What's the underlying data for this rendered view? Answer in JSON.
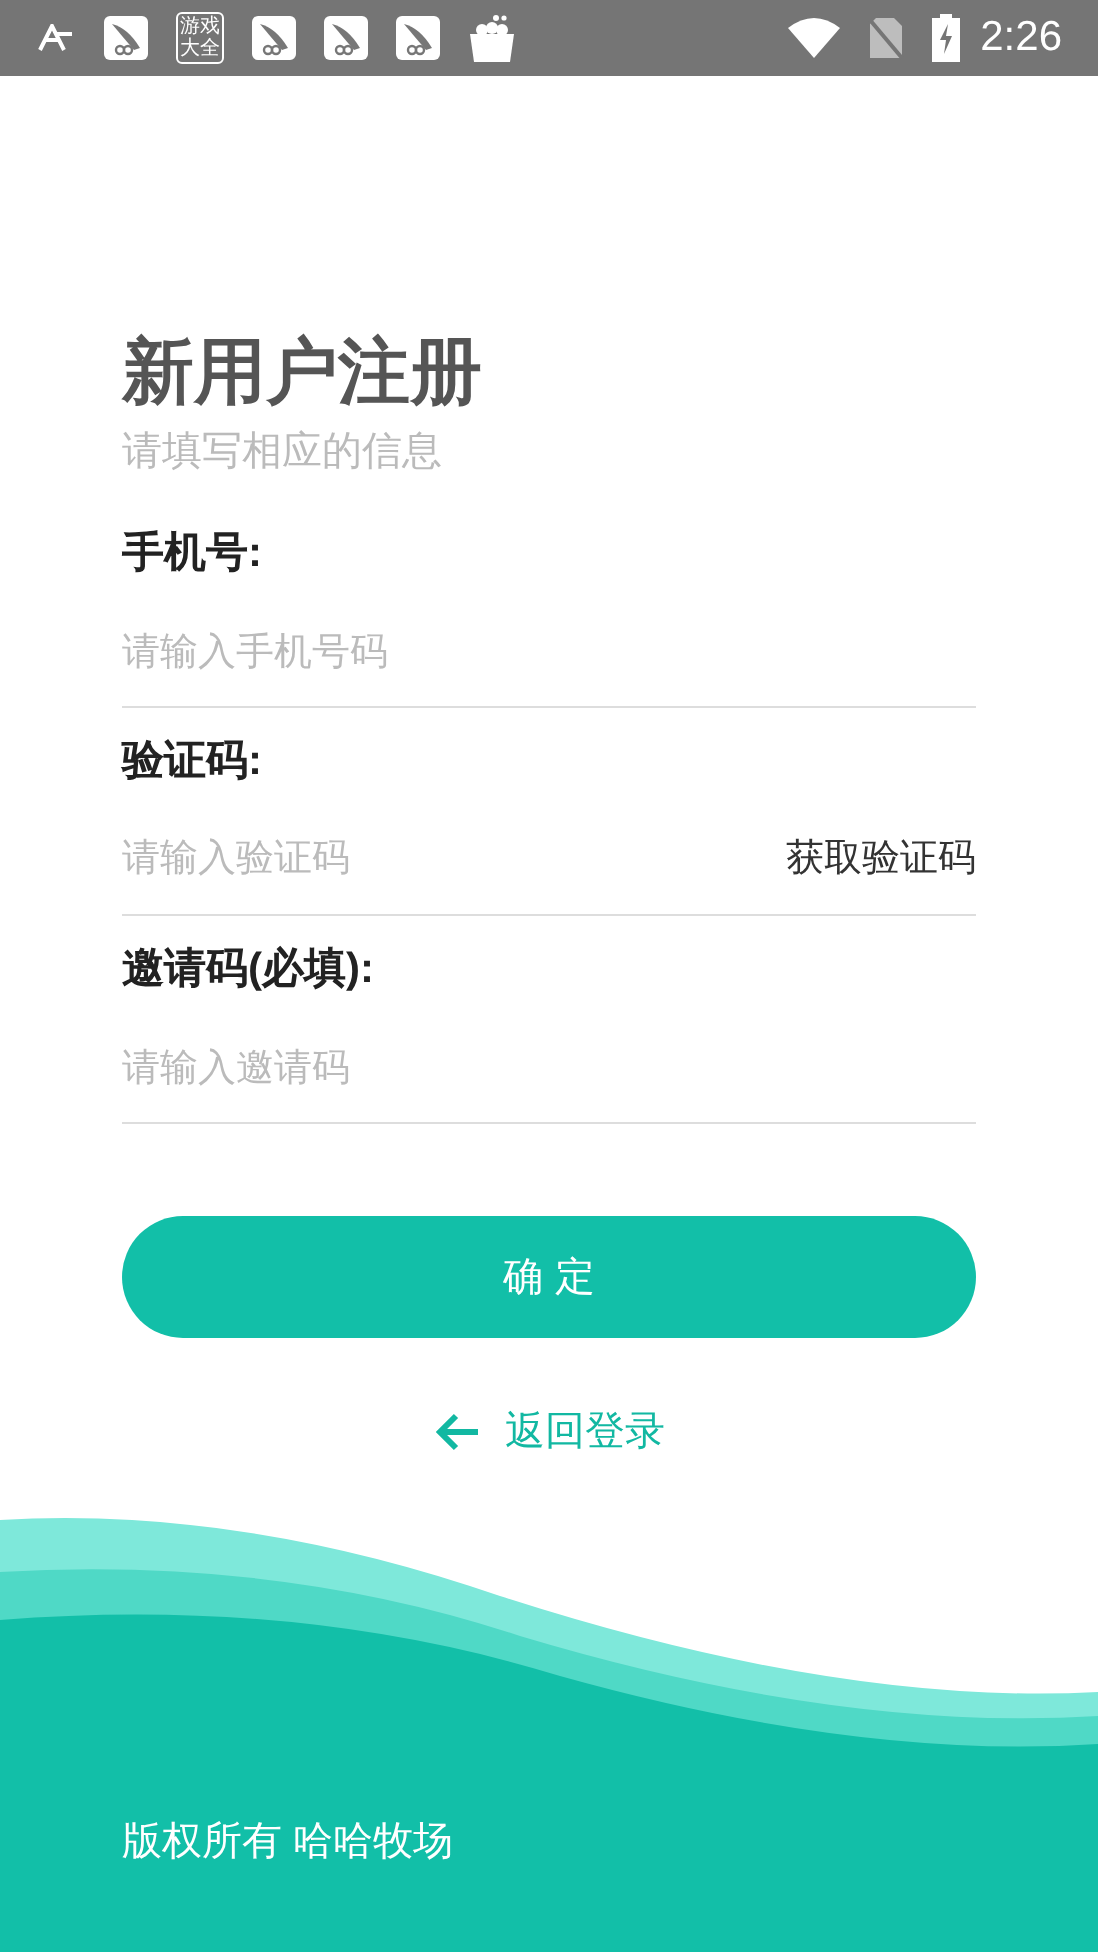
{
  "status_bar": {
    "app_badge": "游戏大全",
    "time": "2:26"
  },
  "title": "新用户注册",
  "subtitle": "请填写相应的信息",
  "fields": [
    {
      "kind": "plain",
      "label": "手机号:",
      "placeholder": "请输入手机号码"
    },
    {
      "kind": "code",
      "label": "验证码:",
      "placeholder": "请输入验证码",
      "action": "获取验证码"
    },
    {
      "kind": "plain",
      "label": "邀请码(必填):",
      "placeholder": "请输入邀请码"
    }
  ],
  "submit": "确 定",
  "back_link": "返回登录",
  "footer": "版权所有 哈哈牧场"
}
